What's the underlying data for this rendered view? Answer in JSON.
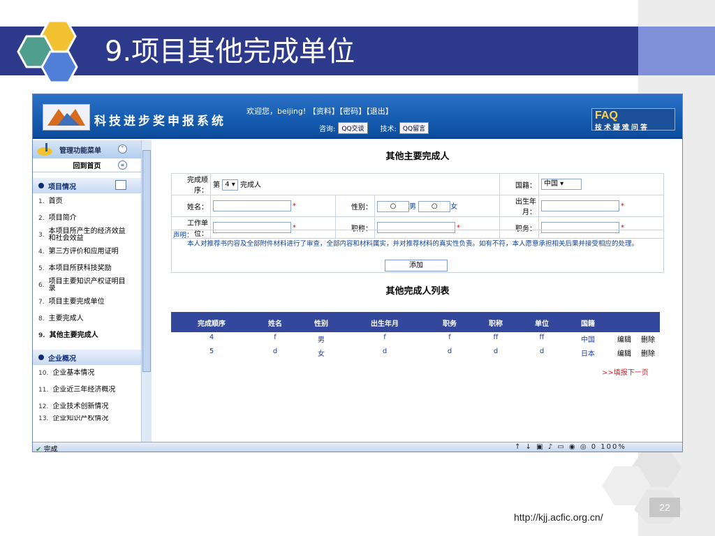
{
  "slide": {
    "title": "9.项目其他完成单位",
    "url": "http://kjj.acfic.org.cn/",
    "page_number": "22"
  },
  "app": {
    "name": "科技进步奖申报系统",
    "welcome": "欢迎您，beijing!",
    "links": [
      "【资料】",
      "【密码】",
      "【退出】"
    ],
    "consult_label": "咨询:",
    "qq_chat": "QQ交谈",
    "tech_label": "技术:",
    "qq_message": "QQ留言",
    "faq_title": "FAQ",
    "faq_sub": "技术疑难问答"
  },
  "sidebar": {
    "menu_title": "管理功能菜单",
    "home": "回到首页",
    "section1": "项目情况",
    "items": [
      {
        "num": "1.",
        "label": "首页"
      },
      {
        "num": "2.",
        "label": "项目简介"
      },
      {
        "num": "3.",
        "label": "本项目所产生的经济效益和社会效益"
      },
      {
        "num": "4.",
        "label": "第三方评价和应用证明"
      },
      {
        "num": "5.",
        "label": "本项目所获科技奖励"
      },
      {
        "num": "6.",
        "label": "项目主要知识产权证明目录"
      },
      {
        "num": "7.",
        "label": "项目主要完成单位"
      },
      {
        "num": "8.",
        "label": "主要完成人"
      },
      {
        "num": "9.",
        "label": "其他主要完成人"
      }
    ],
    "section2": "企业概况",
    "items2": [
      {
        "num": "10.",
        "label": "企业基本情况"
      },
      {
        "num": "11.",
        "label": "企业近三年经济概况"
      },
      {
        "num": "12.",
        "label": "企业技术创新情况"
      },
      {
        "num": "13.",
        "label": "企业知识产权情况"
      }
    ]
  },
  "form": {
    "title": "其他主要完成人",
    "order_label": "完成顺序：",
    "order_prefix": "第",
    "order_value": "4",
    "order_suffix": "完成人",
    "nationality_label": "国籍：",
    "nationality_value": "中国",
    "name_label": "姓名：",
    "gender_label": "性别：",
    "male": "男",
    "female": "女",
    "birth_label": "出生年月：",
    "work_unit_label": "工作单位：",
    "title_label": "职称：",
    "position_label": "职务：",
    "required": "*",
    "statement_label": "声明：",
    "statement_text": "本人对推荐书内容及全部附件材料进行了审查，全部内容和材料属实，并对推荐材料的真实性负责。如有不符，本人愿意承担相关后果并接受相应的处理。",
    "add_button": "添加"
  },
  "list": {
    "title": "其他完成人列表",
    "columns": [
      "完成顺序",
      "姓名",
      "性别",
      "出生年月",
      "职务",
      "职称",
      "单位",
      "国籍"
    ],
    "rows": [
      {
        "order": "4",
        "name": "f",
        "gender": "男",
        "birth": "f",
        "position": "f",
        "title": "ff",
        "unit": "ff",
        "country": "中国",
        "edit": "编辑",
        "delete": "删除"
      },
      {
        "order": "5",
        "name": "d",
        "gender": "女",
        "birth": "d",
        "position": "d",
        "title": "d",
        "unit": "d",
        "country": "日本",
        "edit": "编辑",
        "delete": "删除"
      }
    ],
    "next_link": ">>填报下一页"
  },
  "status": {
    "left": "完成",
    "zoom": "100%"
  },
  "colors": {
    "title_band": "#2d3a8c",
    "header_blue": "#155bb0",
    "list_header": "#33489c",
    "required_red": "#e00000"
  }
}
